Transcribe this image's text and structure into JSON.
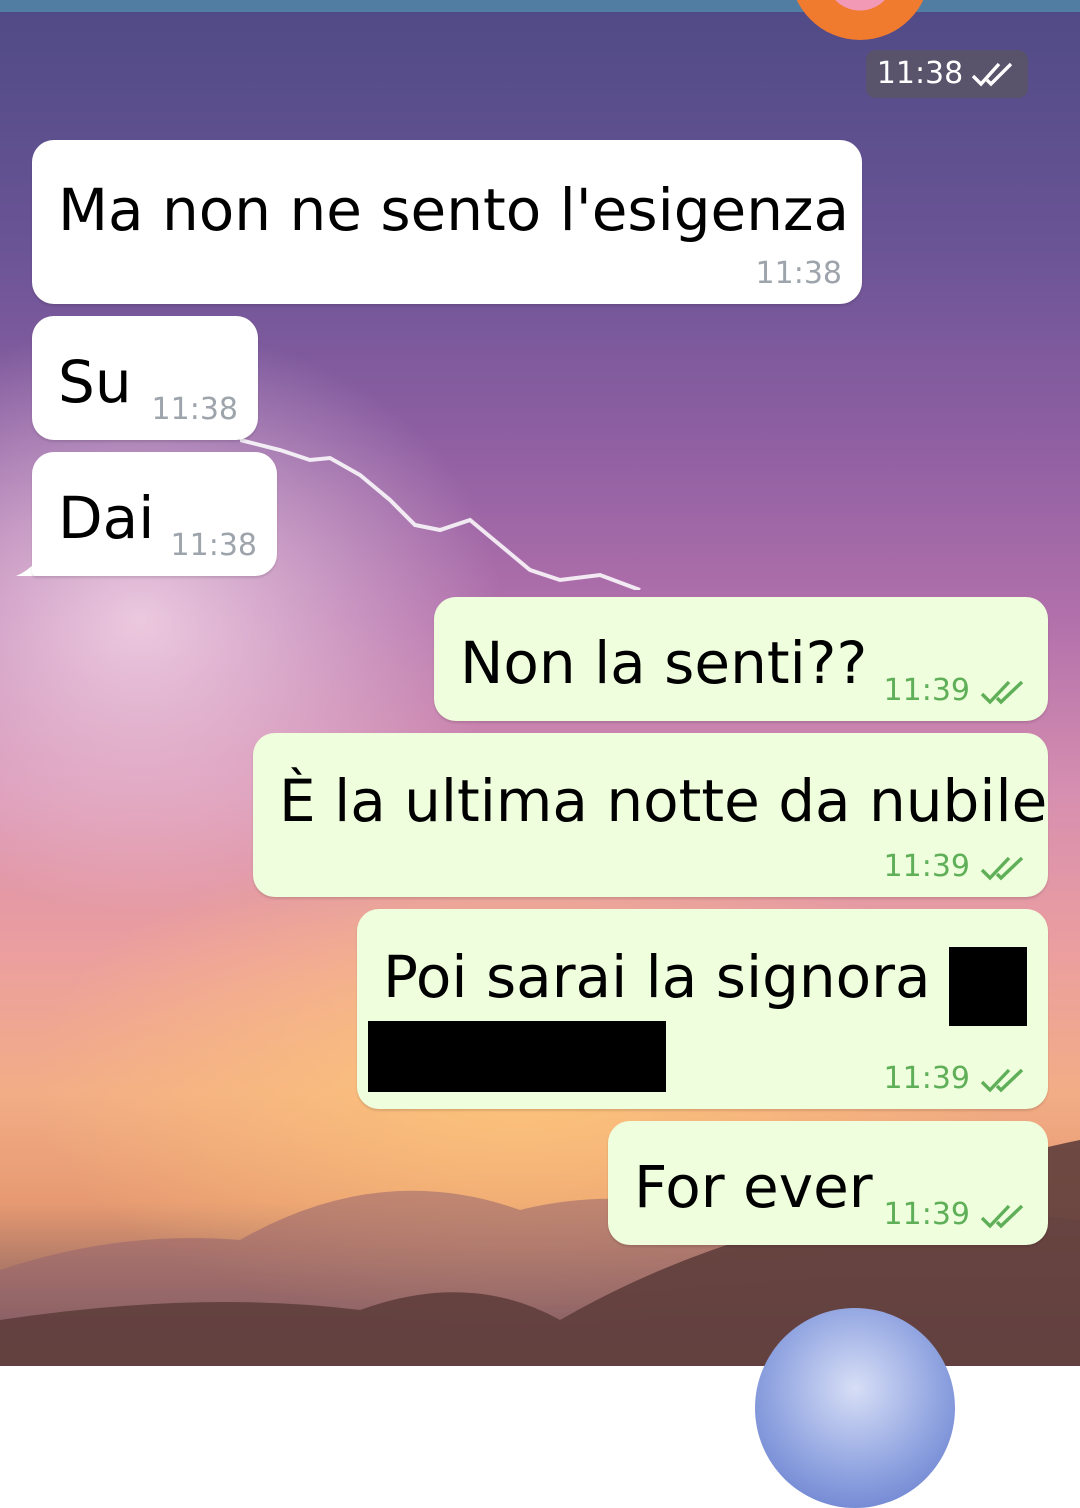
{
  "header": {
    "last_read_time": "11:38"
  },
  "messages": [
    {
      "direction": "incoming",
      "text": "Ma non ne sento l'esigenza",
      "time": "11:38"
    },
    {
      "direction": "incoming",
      "text": "Su",
      "time": "11:38"
    },
    {
      "direction": "incoming",
      "text": "Dai",
      "time": "11:38"
    },
    {
      "direction": "outgoing",
      "text": "Non la senti??",
      "time": "11:39",
      "status": "read"
    },
    {
      "direction": "outgoing",
      "text": "È la ultima notte da nubile",
      "time": "11:39",
      "status": "read"
    },
    {
      "direction": "outgoing",
      "text": "Poi sarai la signora",
      "time": "11:39",
      "status": "read",
      "redacted": true
    },
    {
      "direction": "outgoing",
      "text": "For ever",
      "time": "11:39",
      "status": "read"
    }
  ],
  "colors": {
    "incoming_bubble": "#ffffff",
    "outgoing_bubble": "#effedd",
    "outgoing_time": "#5faf58",
    "incoming_time": "#9ea4ab",
    "top_bar": "#527da3"
  },
  "icons": {
    "read_status": "double-check-icon"
  }
}
